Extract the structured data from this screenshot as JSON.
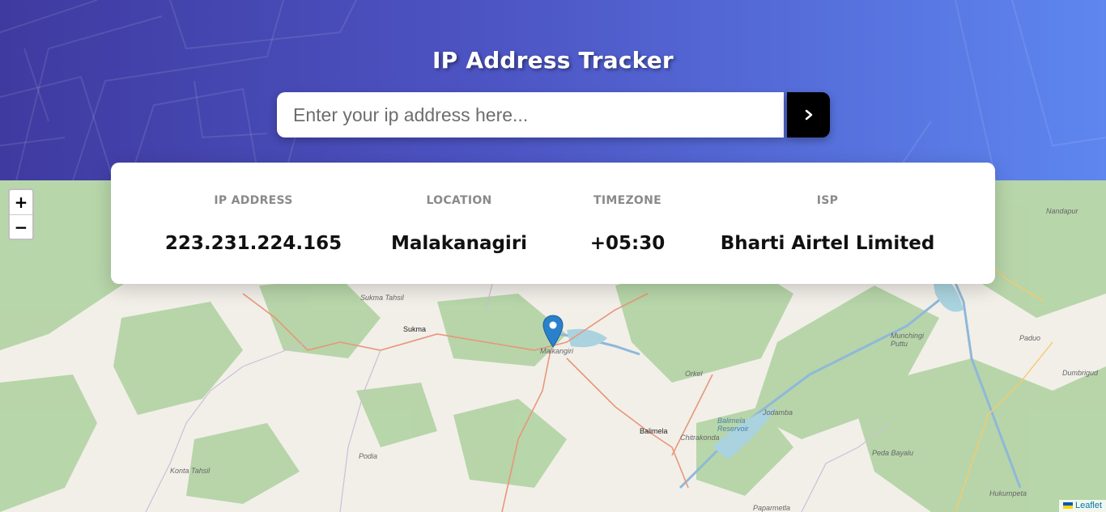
{
  "header": {
    "title": "IP Address Tracker",
    "search_placeholder": "Enter your ip address here...",
    "search_value": "",
    "submit_icon": "chevron-right-icon"
  },
  "info": {
    "ip": {
      "label": "IP ADDRESS",
      "value": "223.231.224.165"
    },
    "location": {
      "label": "LOCATION",
      "value": "Malakanagiri"
    },
    "timezone": {
      "label": "TIMEZONE",
      "value": "+05:30"
    },
    "isp": {
      "label": "ISP",
      "value": "Bharti Airtel Limited"
    }
  },
  "map": {
    "zoom_in": "+",
    "zoom_out": "−",
    "labels": {
      "sukma_tahsil": "Sukma Tahsil",
      "sukma": "Sukma",
      "malkangiri": "Malkangiri",
      "orkel": "Orkel",
      "balimela": "Balimela",
      "chitrakonda": "Chitrakonda",
      "balimela_reservoir": "Balimela Reservoir",
      "jodamba": "Jodamba",
      "munchingi_puttu": "Munchingi Puttu",
      "nandapur": "Nandapur",
      "paduo": "Paduo",
      "dumbriguda": "Dumbrigud",
      "podia": "Podia",
      "konta_tahsil": "Konta Tahsil",
      "peda_bayalu": "Peda Bayalu",
      "hukumpeta": "Hukumpeta",
      "paparmetla": "Paparmetla"
    },
    "attribution": "Leaflet",
    "marker_icon": "map-pin-icon"
  },
  "colors": {
    "header_gradient_start": "#3f3aa0",
    "header_gradient_end": "#5e86ef",
    "button": "#000000",
    "marker": "#2a81cb"
  }
}
